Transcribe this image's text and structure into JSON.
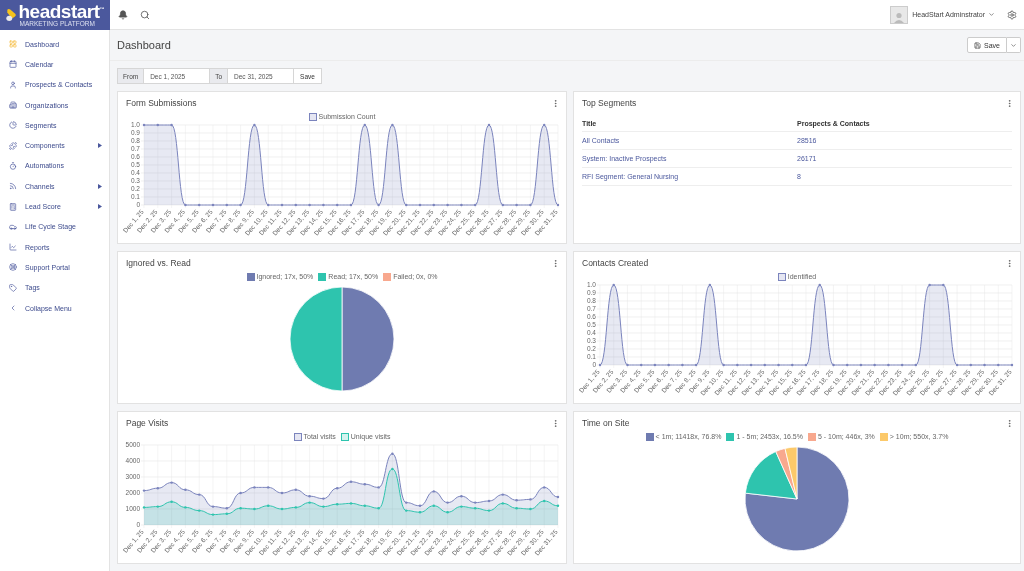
{
  "logo": {
    "name": "headstart",
    "trademark": "™",
    "tagline": "MARKETING PLATFORM"
  },
  "topbar": {
    "user": "HeadStart Adminstrator"
  },
  "sidebar": {
    "items": [
      {
        "label": "Dashboard",
        "selected": true,
        "expandable": false
      },
      {
        "label": "Calendar",
        "selected": false,
        "expandable": false
      },
      {
        "label": "Prospects & Contacts",
        "selected": false,
        "expandable": false
      },
      {
        "label": "Organizations",
        "selected": false,
        "expandable": false
      },
      {
        "label": "Segments",
        "selected": false,
        "expandable": false
      },
      {
        "label": "Components",
        "selected": false,
        "expandable": true
      },
      {
        "label": "Automations",
        "selected": false,
        "expandable": false
      },
      {
        "label": "Channels",
        "selected": false,
        "expandable": true
      },
      {
        "label": "Lead Score",
        "selected": false,
        "expandable": true
      },
      {
        "label": "Life Cycle Stage",
        "selected": false,
        "expandable": false
      },
      {
        "label": "Reports",
        "selected": false,
        "expandable": false
      },
      {
        "label": "Support Portal",
        "selected": false,
        "expandable": false
      },
      {
        "label": "Tags",
        "selected": false,
        "expandable": false
      },
      {
        "label": "Collapse Menu",
        "selected": false,
        "expandable": false
      }
    ]
  },
  "page": {
    "title": "Dashboard",
    "save_button": "Save"
  },
  "date_filter": {
    "from_label": "From",
    "from_value": "Dec 1, 2025",
    "to_label": "To",
    "to_value": "Dec 31, 2025",
    "save_button": "Save"
  },
  "cards": [
    {
      "kind": "chart",
      "title": "Form Submissions",
      "chart_data": {
        "type": "area",
        "categories": [
          "Dec 1, 25",
          "Dec 2, 25",
          "Dec 3, 25",
          "Dec 4, 25",
          "Dec 5, 25",
          "Dec 6, 25",
          "Dec 7, 25",
          "Dec 8, 25",
          "Dec 9, 25",
          "Dec 10, 25",
          "Dec 11, 25",
          "Dec 12, 25",
          "Dec 13, 25",
          "Dec 14, 25",
          "Dec 15, 25",
          "Dec 16, 25",
          "Dec 17, 25",
          "Dec 18, 25",
          "Dec 19, 25",
          "Dec 20, 25",
          "Dec 21, 25",
          "Dec 22, 25",
          "Dec 23, 25",
          "Dec 24, 25",
          "Dec 25, 25",
          "Dec 26, 25",
          "Dec 27, 25",
          "Dec 28, 25",
          "Dec 29, 25",
          "Dec 30, 25",
          "Dec 31, 25"
        ],
        "series": [
          {
            "name": "Submission Count",
            "color": "#7b84bd",
            "values": [
              1,
              1,
              1,
              0,
              0,
              0,
              0,
              0,
              1,
              0,
              0,
              0,
              0,
              0,
              0,
              0,
              1,
              0,
              1,
              0,
              0,
              0,
              0,
              0,
              0,
              1,
              0,
              0,
              0,
              1,
              0
            ]
          }
        ],
        "ylim": [
          0,
          1
        ],
        "yticks": [
          0,
          0.1,
          0.2,
          0.3,
          0.4,
          0.5,
          0.6,
          0.7,
          0.8,
          0.9,
          {
            "value": 1,
            "label": "1.0"
          }
        ],
        "grid": true
      }
    },
    {
      "kind": "table",
      "title": "Top Segments",
      "columns": [
        "Title",
        "Prospects & Contacts"
      ],
      "rows": [
        [
          "All Contacts",
          "28516"
        ],
        [
          "System: Inactive Prospects",
          "26171"
        ],
        [
          "RFI Segment: General Nursing",
          "8"
        ]
      ]
    },
    {
      "kind": "pie",
      "title": "Ignored vs. Read",
      "chart_data": {
        "type": "pie",
        "categories": [
          "Ignored; 17x, 50%",
          "Read; 17x, 50%",
          "Failed; 0x, 0%"
        ],
        "values": [
          17,
          17,
          0
        ],
        "colors": [
          "#6f7bb0",
          "#2ec4ae",
          "#f8a88e"
        ]
      }
    },
    {
      "kind": "chart",
      "title": "Contacts Created",
      "chart_data": {
        "type": "area",
        "categories": [
          "Dec 1, 25",
          "Dec 2, 25",
          "Dec 3, 25",
          "Dec 4, 25",
          "Dec 5, 25",
          "Dec 6, 25",
          "Dec 7, 25",
          "Dec 8, 25",
          "Dec 9, 25",
          "Dec 10, 25",
          "Dec 11, 25",
          "Dec 12, 25",
          "Dec 13, 25",
          "Dec 14, 25",
          "Dec 15, 25",
          "Dec 16, 25",
          "Dec 17, 25",
          "Dec 18, 25",
          "Dec 19, 25",
          "Dec 20, 25",
          "Dec 21, 25",
          "Dec 22, 25",
          "Dec 23, 25",
          "Dec 24, 25",
          "Dec 25, 25",
          "Dec 26, 25",
          "Dec 27, 25",
          "Dec 28, 25",
          "Dec 29, 25",
          "Dec 30, 25",
          "Dec 31, 25"
        ],
        "series": [
          {
            "name": "Identified",
            "color": "#7b84bd",
            "values": [
              0,
              1,
              0,
              0,
              0,
              0,
              0,
              0,
              1,
              0,
              0,
              0,
              0,
              0,
              0,
              0,
              1,
              0,
              0,
              0,
              0,
              0,
              0,
              0,
              1,
              1,
              0,
              0,
              0,
              0,
              0
            ]
          }
        ],
        "ylim": [
          0,
          1
        ],
        "yticks": [
          0,
          0.1,
          0.2,
          0.3,
          0.4,
          0.5,
          0.6,
          0.7,
          0.8,
          0.9,
          {
            "value": 1,
            "label": "1.0"
          }
        ],
        "grid": true
      }
    },
    {
      "kind": "chart",
      "title": "Page Visits",
      "chart_data": {
        "type": "area",
        "categories": [
          "Dec 1, 25",
          "Dec 2, 25",
          "Dec 3, 25",
          "Dec 4, 25",
          "Dec 5, 25",
          "Dec 6, 25",
          "Dec 7, 25",
          "Dec 8, 25",
          "Dec 9, 25",
          "Dec 10, 25",
          "Dec 11, 25",
          "Dec 12, 25",
          "Dec 13, 25",
          "Dec 14, 25",
          "Dec 15, 25",
          "Dec 16, 25",
          "Dec 17, 25",
          "Dec 18, 25",
          "Dec 19, 25",
          "Dec 20, 25",
          "Dec 21, 25",
          "Dec 22, 25",
          "Dec 23, 25",
          "Dec 24, 25",
          "Dec 25, 25",
          "Dec 26, 25",
          "Dec 27, 25",
          "Dec 28, 25",
          "Dec 29, 25",
          "Dec 30, 25",
          "Dec 31, 25"
        ],
        "series": [
          {
            "name": "Total visits",
            "color": "#7b84bd",
            "values": [
              2150,
              2300,
              2650,
              2200,
              1900,
              1150,
              1050,
              2000,
              2350,
              2350,
              2000,
              2200,
              1800,
              1650,
              2300,
              2700,
              2550,
              2350,
              4450,
              1400,
              1200,
              2100,
              1400,
              1800,
              1400,
              1500,
              1900,
              1550,
              1600,
              2350,
              1750
            ]
          },
          {
            "name": "Unique visits",
            "color": "#2ec4ae",
            "values": [
              1100,
              1150,
              1450,
              1100,
              900,
              650,
              700,
              1050,
              1000,
              1200,
              1000,
              1100,
              1400,
              1150,
              1300,
              1350,
              1200,
              1050,
              3500,
              900,
              800,
              1200,
              800,
              1150,
              1050,
              900,
              1350,
              1050,
              1000,
              1500,
              1200
            ]
          }
        ],
        "ylim": [
          0,
          5000
        ],
        "yticks": [
          0,
          1000,
          2000,
          3000,
          4000,
          5000
        ],
        "grid": true
      }
    },
    {
      "kind": "pie",
      "title": "Time on Site",
      "chart_data": {
        "type": "pie",
        "categories": [
          "< 1m; 11418x, 76.8%",
          "1 - 5m; 2453x, 16.5%",
          "5 - 10m; 446x, 3%",
          "> 10m; 550x, 3.7%"
        ],
        "values": [
          11418,
          2453,
          446,
          550
        ],
        "colors": [
          "#6f7bb0",
          "#2ec4ae",
          "#f8a88e",
          "#fcc96a"
        ]
      }
    }
  ]
}
